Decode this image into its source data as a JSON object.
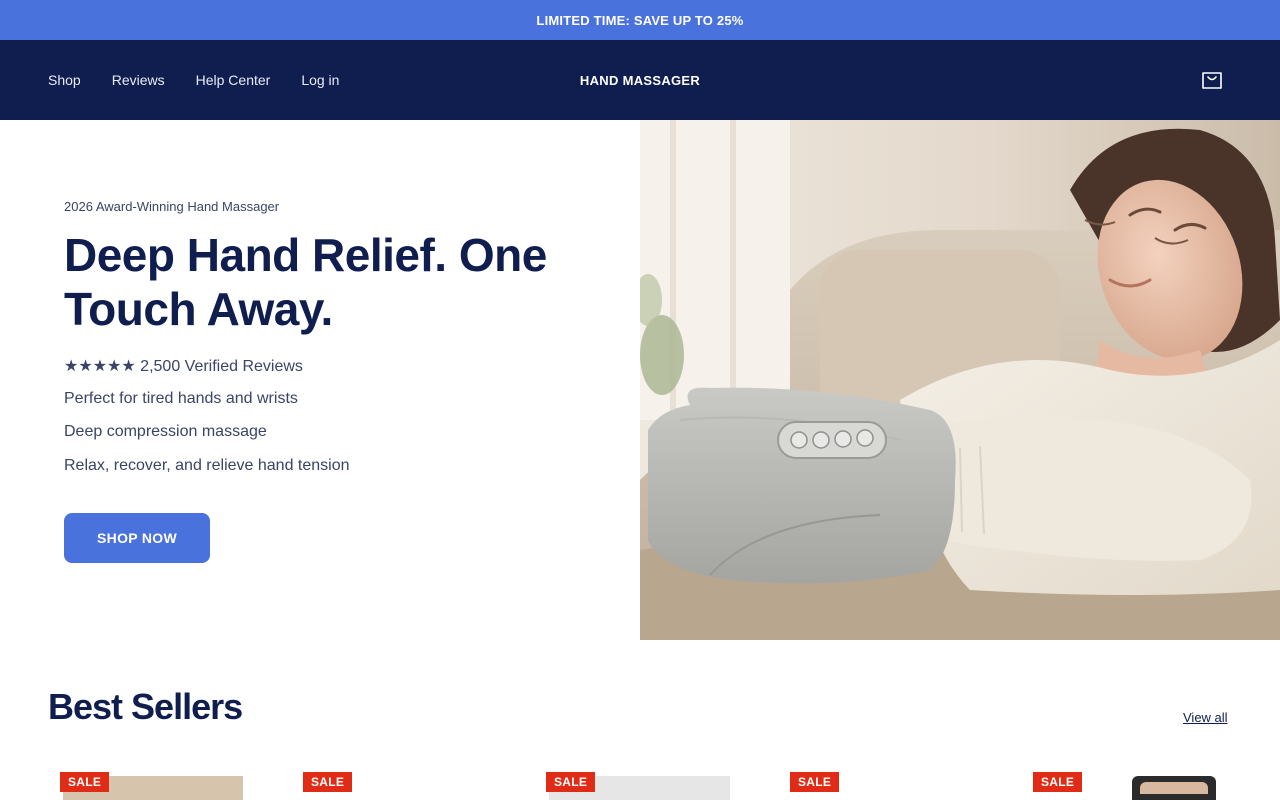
{
  "announcement": {
    "text": "LIMITED TIME: SAVE UP TO 25%"
  },
  "header": {
    "nav": [
      {
        "label": "Shop"
      },
      {
        "label": "Reviews"
      },
      {
        "label": "Help Center"
      },
      {
        "label": "Log in"
      }
    ],
    "brand": "HAND MASSAGER",
    "cart_icon": "cart-icon"
  },
  "hero": {
    "eyebrow": "2026 Award-Winning Hand Massager",
    "headline": "Deep Hand Relief. One Touch Away.",
    "rating": {
      "stars": "★★★★★",
      "rating_value": 5,
      "text": "2,500 Verified Reviews"
    },
    "features": [
      "Perfect for tired hands and wrists",
      "Deep compression massage",
      "Relax, recover, and relieve hand tension"
    ],
    "cta_label": "SHOP NOW"
  },
  "best_sellers": {
    "title": "Best Sellers",
    "view_all": "View all",
    "products": [
      {
        "badge": "SALE"
      },
      {
        "badge": "SALE"
      },
      {
        "badge": "SALE"
      },
      {
        "badge": "SALE"
      },
      {
        "badge": "SALE"
      }
    ]
  },
  "colors": {
    "accent": "#4a72dc",
    "navy": "#0f1d4f",
    "sale": "#e02b16",
    "body_text": "#3b4466"
  }
}
